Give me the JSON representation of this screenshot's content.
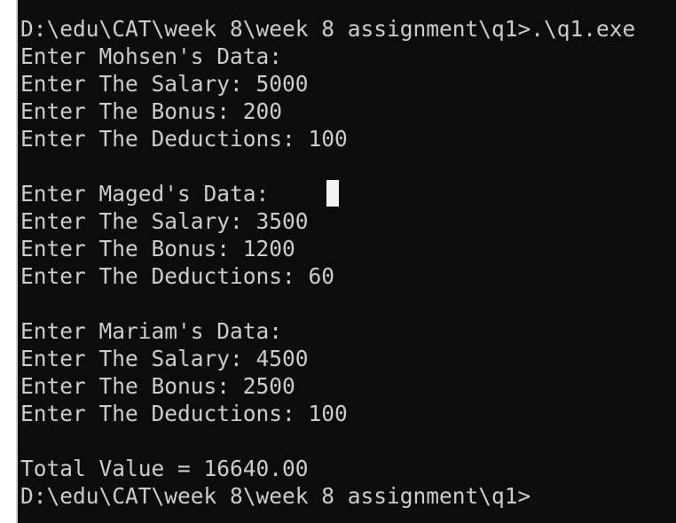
{
  "terminal": {
    "lines": [
      "D:\\edu\\CAT\\week 8\\week 8 assignment\\q1>.\\q1.exe",
      "Enter Mohsen's Data:",
      "Enter The Salary: 5000",
      "Enter The Bonus: 200",
      "Enter The Deductions: 100",
      "",
      "Enter Maged's Data:",
      "Enter The Salary: 3500",
      "Enter The Bonus: 1200",
      "Enter The Deductions: 60",
      "",
      "Enter Mariam's Data:",
      "Enter The Salary: 4500",
      "Enter The Bonus: 2500",
      "Enter The Deductions: 100",
      "",
      "Total Value = 16640.00",
      "D:\\edu\\CAT\\week 8\\week 8 assignment\\q1>"
    ]
  },
  "colors": {
    "background": "#0c0c0c",
    "text": "#cccccc",
    "cursor": "#f2f2f2"
  }
}
